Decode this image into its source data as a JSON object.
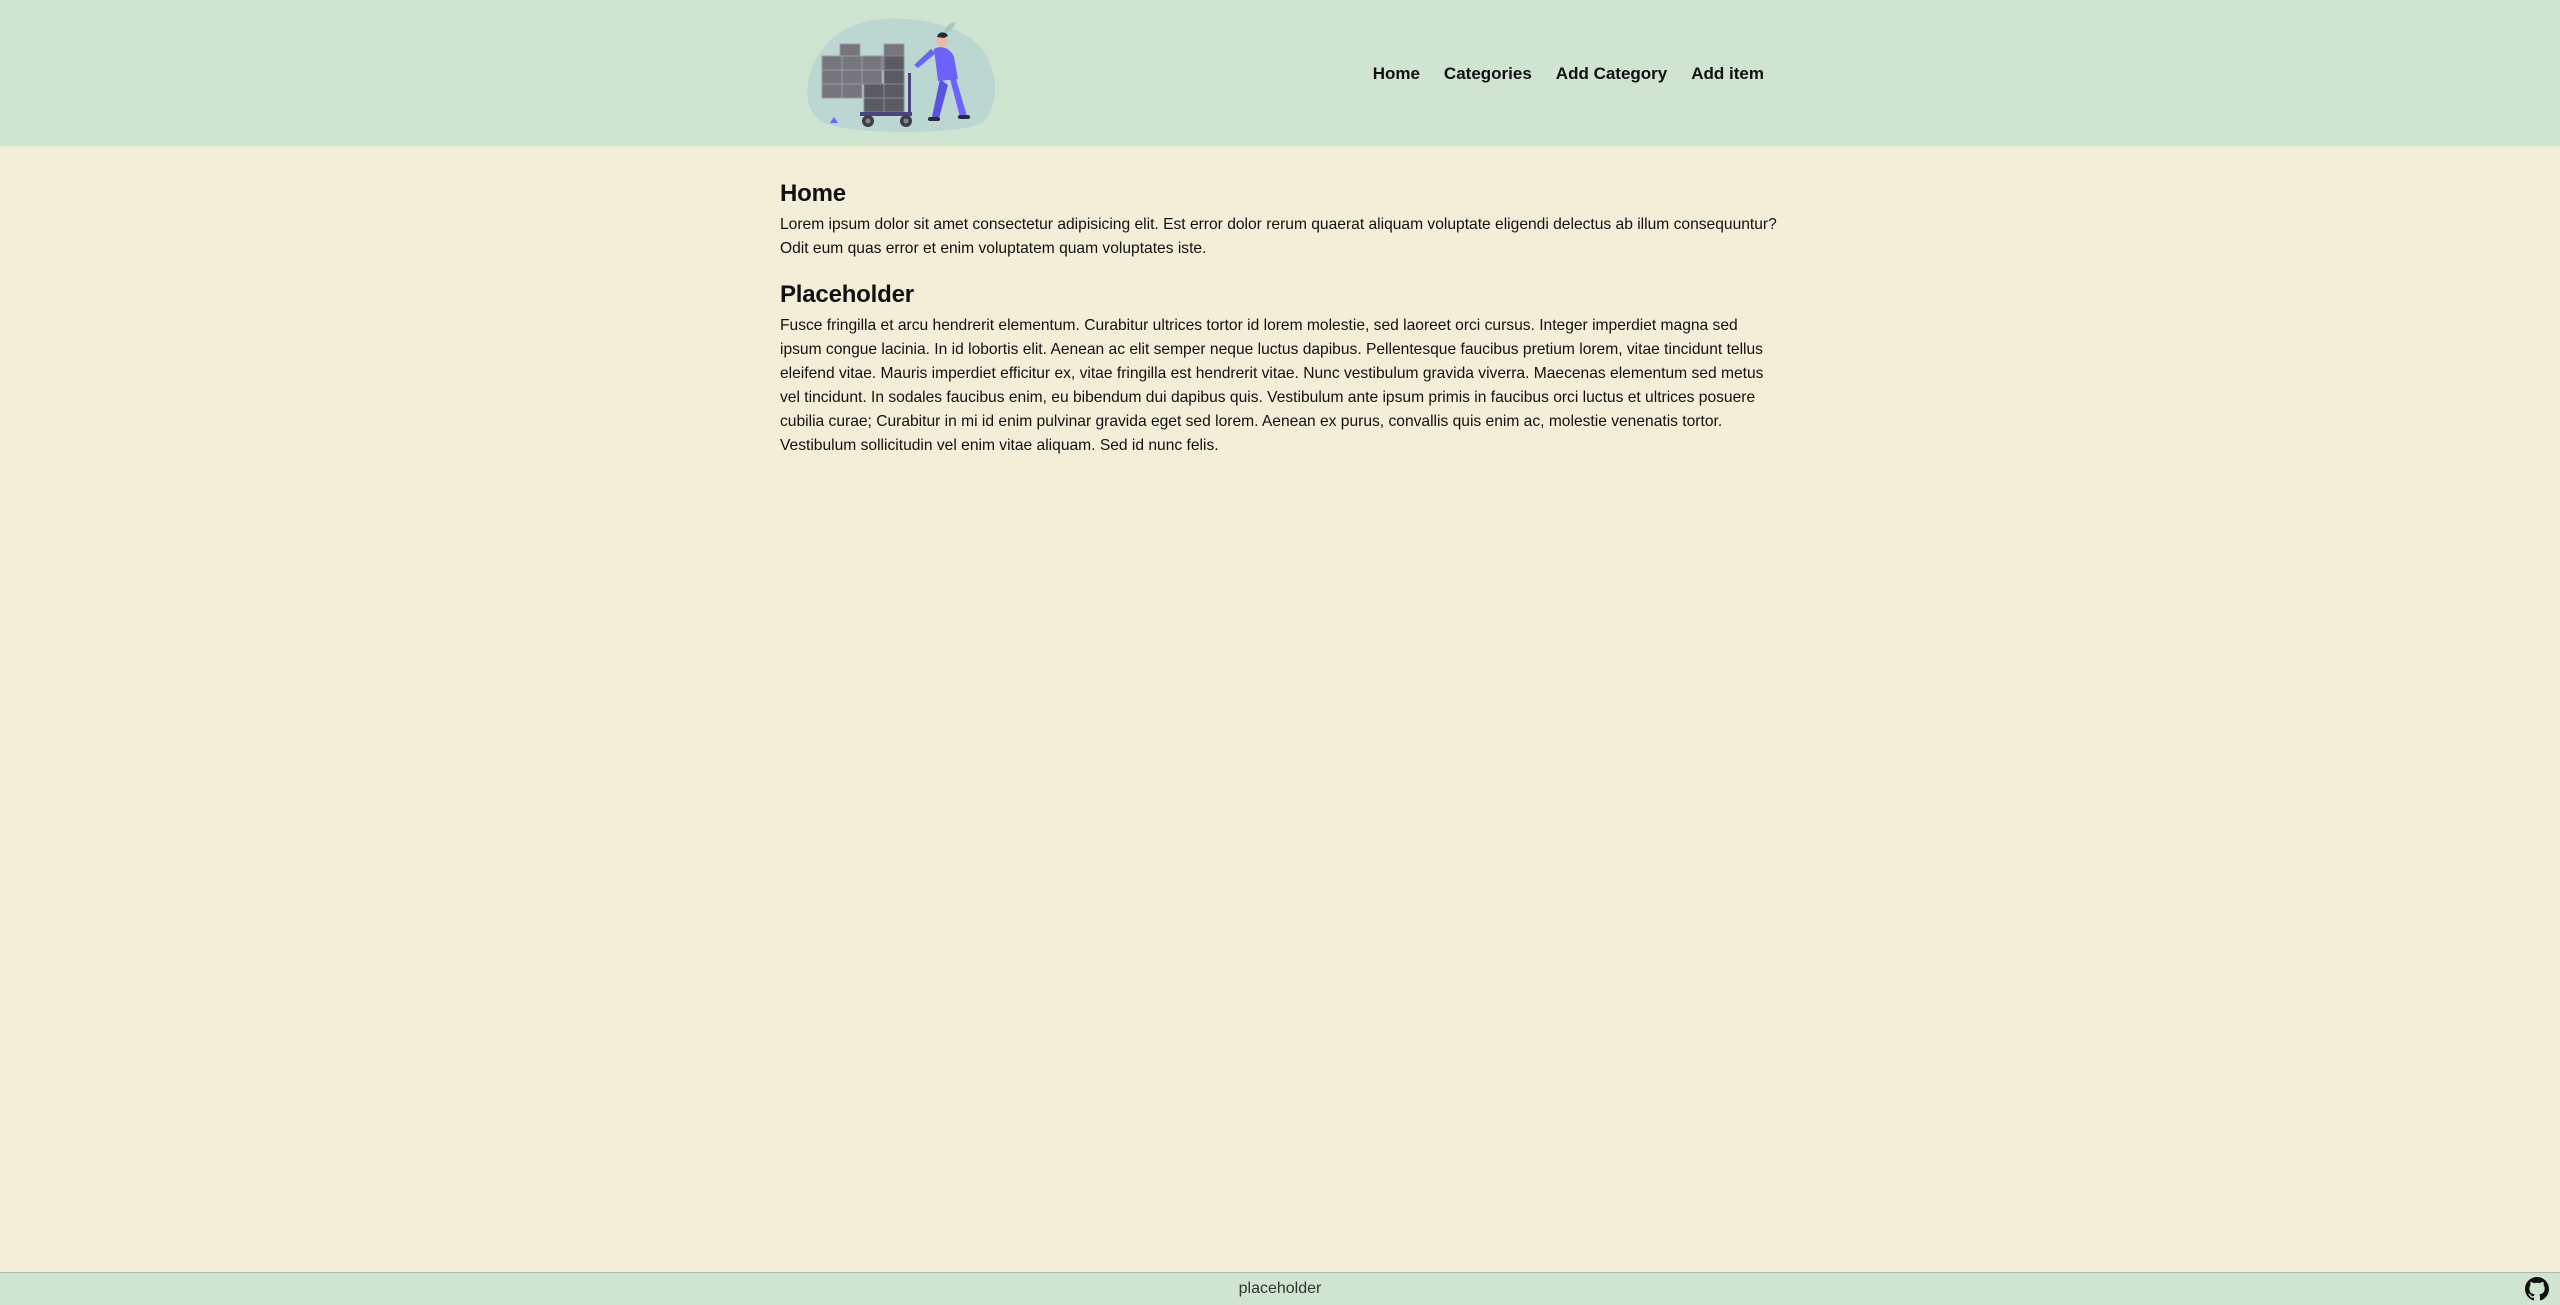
{
  "header": {
    "nav": [
      {
        "label": "Home"
      },
      {
        "label": "Categories"
      },
      {
        "label": "Add Category"
      },
      {
        "label": "Add item"
      }
    ]
  },
  "main": {
    "sections": [
      {
        "heading": "Home",
        "body": "Lorem ipsum dolor sit amet consectetur adipisicing elit. Est error dolor rerum quaerat aliquam voluptate eligendi delectus ab illum consequuntur? Odit eum quas error et enim voluptatem quam voluptates iste."
      },
      {
        "heading": "Placeholder",
        "body": "Fusce fringilla et arcu hendrerit elementum. Curabitur ultrices tortor id lorem molestie, sed laoreet orci cursus. Integer imperdiet magna sed ipsum congue lacinia. In id lobortis elit. Aenean ac elit semper neque luctus dapibus. Pellentesque faucibus pretium lorem, vitae tincidunt tellus eleifend vitae. Mauris imperdiet efficitur ex, vitae fringilla est hendrerit vitae. Nunc vestibulum gravida viverra. Maecenas elementum sed metus vel tincidunt. In sodales faucibus enim, eu bibendum dui dapibus quis. Vestibulum ante ipsum primis in faucibus orci luctus et ultrices posuere cubilia curae; Curabitur in mi id enim pulvinar gravida eget sed lorem. Aenean ex purus, convallis quis enim ac, molestie venenatis tortor. Vestibulum sollicitudin vel enim vitae aliquam. Sed id nunc felis."
      }
    ]
  },
  "footer": {
    "text": "placeholder",
    "icon": "github-icon"
  },
  "colors": {
    "header_bg": "#cfe4d1",
    "page_bg": "#f3eed8",
    "accent": "#6c63ff"
  }
}
